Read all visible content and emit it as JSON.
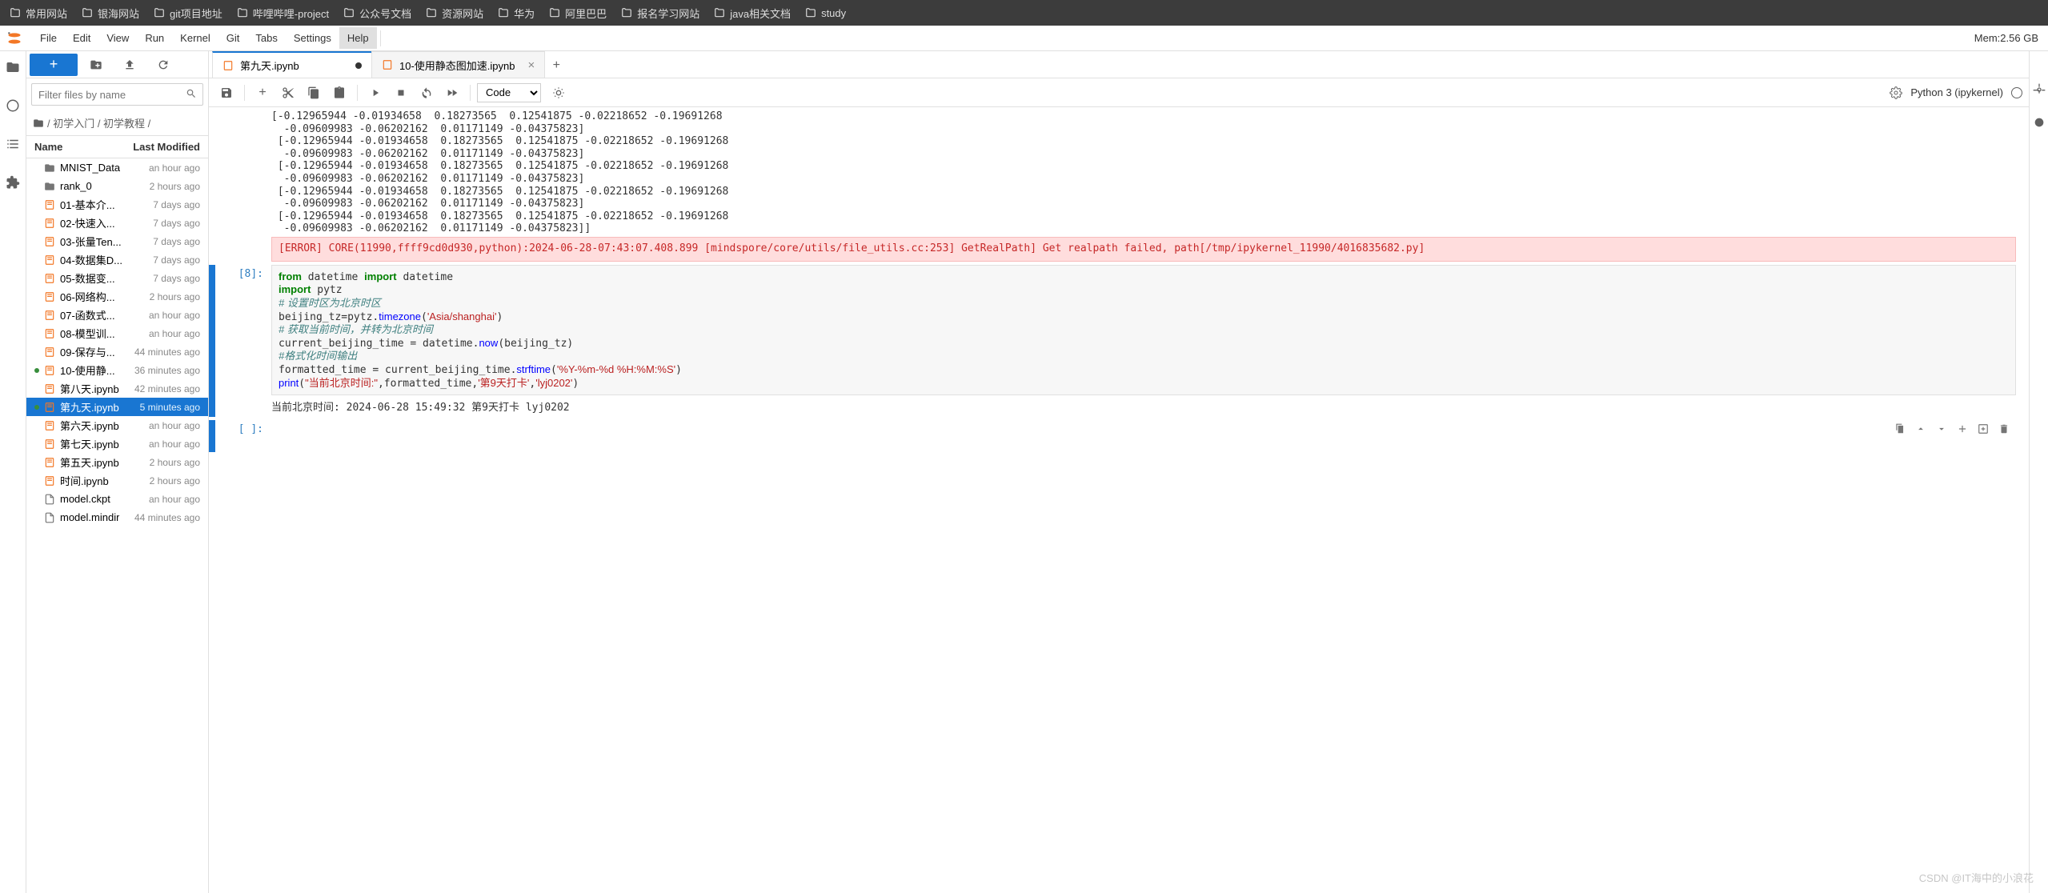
{
  "bookmarks": [
    "常用网站",
    "银海网站",
    "git项目地址",
    "哔哩哔哩-project",
    "公众号文档",
    "资源网站",
    "华为",
    "阿里巴巴",
    "报名学习网站",
    "java相关文档",
    "study"
  ],
  "menu": [
    "File",
    "Edit",
    "View",
    "Run",
    "Kernel",
    "Git",
    "Tabs",
    "Settings",
    "Help"
  ],
  "menu_active_index": 8,
  "mem_text": "Mem:2.56 GB",
  "filter_placeholder": "Filter files by name",
  "crumb_parts": [
    "/",
    "初学入门",
    "/",
    "初学教程",
    "/"
  ],
  "fp_header": {
    "name": "Name",
    "mod": "Last Modified"
  },
  "files": [
    {
      "type": "folder",
      "name": "MNIST_Data",
      "mod": "an hour ago"
    },
    {
      "type": "folder",
      "name": "rank_0",
      "mod": "2 hours ago"
    },
    {
      "type": "nb",
      "name": "01-基本介...",
      "mod": "7 days ago"
    },
    {
      "type": "nb",
      "name": "02-快速入...",
      "mod": "7 days ago"
    },
    {
      "type": "nb",
      "name": "03-张量Ten...",
      "mod": "7 days ago"
    },
    {
      "type": "nb",
      "name": "04-数据集D...",
      "mod": "7 days ago"
    },
    {
      "type": "nb",
      "name": "05-数据变...",
      "mod": "7 days ago"
    },
    {
      "type": "nb",
      "name": "06-网络构...",
      "mod": "2 hours ago"
    },
    {
      "type": "nb",
      "name": "07-函数式...",
      "mod": "an hour ago"
    },
    {
      "type": "nb",
      "name": "08-模型训...",
      "mod": "an hour ago"
    },
    {
      "type": "nb",
      "name": "09-保存与...",
      "mod": "44 minutes ago"
    },
    {
      "type": "nb",
      "name": "10-使用静...",
      "mod": "36 minutes ago",
      "running": true
    },
    {
      "type": "nb",
      "name": "第八天.ipynb",
      "mod": "42 minutes ago"
    },
    {
      "type": "nb",
      "name": "第九天.ipynb",
      "mod": "5 minutes ago",
      "selected": true,
      "running": true
    },
    {
      "type": "nb",
      "name": "第六天.ipynb",
      "mod": "an hour ago"
    },
    {
      "type": "nb",
      "name": "第七天.ipynb",
      "mod": "an hour ago"
    },
    {
      "type": "nb",
      "name": "第五天.ipynb",
      "mod": "2 hours ago"
    },
    {
      "type": "nb",
      "name": "时间.ipynb",
      "mod": "2 hours ago"
    },
    {
      "type": "file",
      "name": "model.ckpt",
      "mod": "an hour ago"
    },
    {
      "type": "file",
      "name": "model.mindir",
      "mod": "44 minutes ago"
    }
  ],
  "tabs": [
    {
      "label": "第九天.ipynb",
      "dirty": true,
      "active": true
    },
    {
      "label": "10-使用静态图加速.ipynb",
      "dirty": false,
      "active": false
    }
  ],
  "celltype": "Code",
  "kernel_name": "Python 3 (ipykernel)",
  "output_lines": [
    "[-0.12965944 -0.01934658  0.18273565  0.12541875 -0.02218652 -0.19691268",
    "  -0.09609983 -0.06202162  0.01171149 -0.04375823]",
    " [-0.12965944 -0.01934658  0.18273565  0.12541875 -0.02218652 -0.19691268",
    "  -0.09609983 -0.06202162  0.01171149 -0.04375823]",
    " [-0.12965944 -0.01934658  0.18273565  0.12541875 -0.02218652 -0.19691268",
    "  -0.09609983 -0.06202162  0.01171149 -0.04375823]",
    " [-0.12965944 -0.01934658  0.18273565  0.12541875 -0.02218652 -0.19691268",
    "  -0.09609983 -0.06202162  0.01171149 -0.04375823]",
    " [-0.12965944 -0.01934658  0.18273565  0.12541875 -0.02218652 -0.19691268",
    "  -0.09609983 -0.06202162  0.01171149 -0.04375823]]"
  ],
  "error_text": "[ERROR] CORE(11990,ffff9cd0d930,python):2024-06-28-07:43:07.408.899 [mindspore/core/utils/file_utils.cc:253] GetRealPath] Get realpath failed, path[/tmp/ipykernel_11990/4016835682.py]",
  "cell_in_prompt": "[8]:",
  "code_lines": [
    {
      "segs": [
        {
          "t": "from",
          "c": "kw"
        },
        {
          "t": " datetime "
        },
        {
          "t": "import",
          "c": "kw"
        },
        {
          "t": " datetime"
        }
      ]
    },
    {
      "segs": [
        {
          "t": "import",
          "c": "kw"
        },
        {
          "t": " pytz"
        }
      ]
    },
    {
      "segs": [
        {
          "t": "# 设置时区为北京时区",
          "c": "cm"
        }
      ]
    },
    {
      "segs": [
        {
          "t": "beijing_tz=pytz."
        },
        {
          "t": "timezone",
          "c": "fn"
        },
        {
          "t": "("
        },
        {
          "t": "'Asia/shanghai'",
          "c": "str"
        },
        {
          "t": ")"
        }
      ]
    },
    {
      "segs": [
        {
          "t": "# 获取当前时间，并转为北京时间",
          "c": "cm"
        }
      ]
    },
    {
      "segs": [
        {
          "t": "current_beijing_time = datetime."
        },
        {
          "t": "now",
          "c": "fn"
        },
        {
          "t": "(beijing_tz)"
        }
      ]
    },
    {
      "segs": [
        {
          "t": "#格式化时间输出",
          "c": "cm"
        }
      ]
    },
    {
      "segs": [
        {
          "t": "formatted_time = current_beijing_time."
        },
        {
          "t": "strftime",
          "c": "fn"
        },
        {
          "t": "("
        },
        {
          "t": "'%Y-%m-%d %H:%M:%S'",
          "c": "str"
        },
        {
          "t": ")"
        }
      ]
    },
    {
      "segs": [
        {
          "t": "print",
          "c": "fn"
        },
        {
          "t": "("
        },
        {
          "t": "\"当前北京时间:\"",
          "c": "str"
        },
        {
          "t": ",formatted_time,"
        },
        {
          "t": "'第9天打卡'",
          "c": "str"
        },
        {
          "t": ","
        },
        {
          "t": "'lyj0202'",
          "c": "str"
        },
        {
          "t": ")"
        }
      ]
    }
  ],
  "cell_out_text": "当前北京时间: 2024-06-28 15:49:32 第9天打卡 lyj0202",
  "empty_prompt": "[ ]:",
  "watermark": "CSDN @IT海中的小浪花"
}
